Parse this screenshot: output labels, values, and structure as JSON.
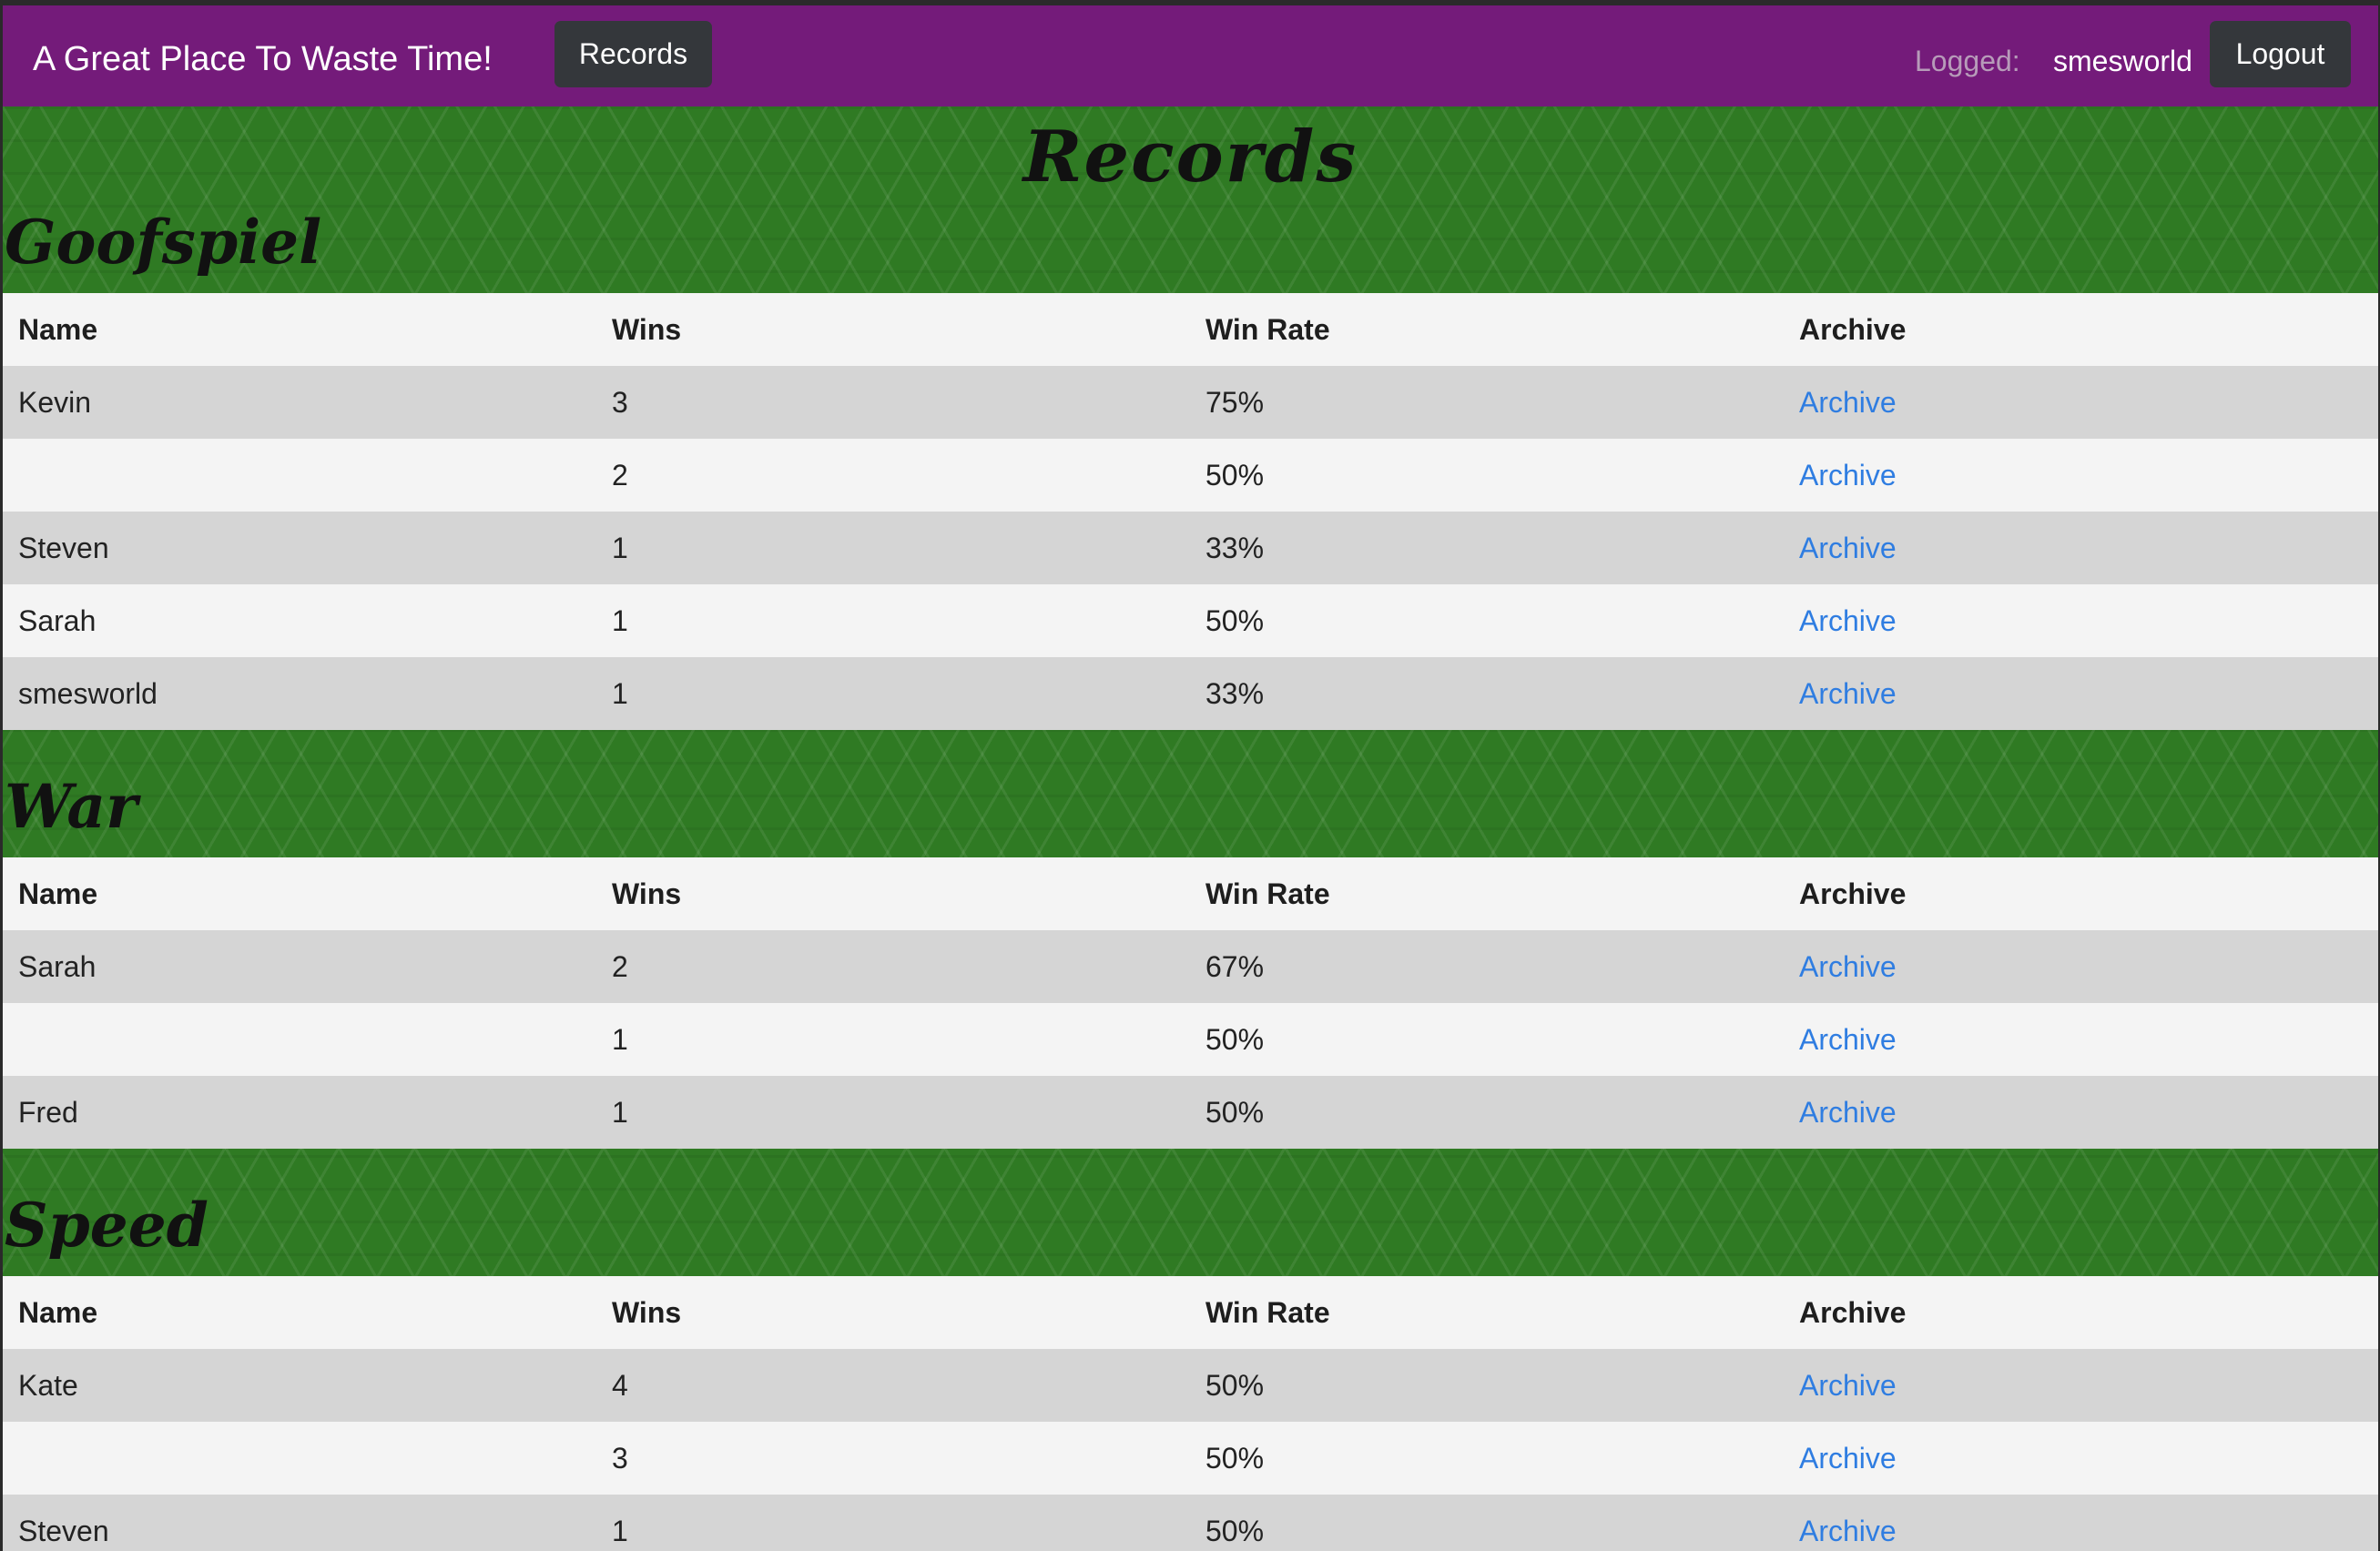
{
  "navbar": {
    "brand": "A Great Place To Waste Time!",
    "records_button": "Records",
    "logged_label": "Logged:",
    "username": "smesworld",
    "logout_button": "Logout"
  },
  "page": {
    "title": "Records"
  },
  "sections": [
    {
      "title": "Goofspiel",
      "headers": [
        "Name",
        "Wins",
        "Win Rate",
        "Archive"
      ],
      "rows": [
        {
          "name": "Kevin",
          "wins": "3",
          "rate": "75%",
          "archive": "Archive"
        },
        {
          "name": "",
          "wins": "2",
          "rate": "50%",
          "archive": "Archive"
        },
        {
          "name": "Steven",
          "wins": "1",
          "rate": "33%",
          "archive": "Archive"
        },
        {
          "name": "Sarah",
          "wins": "1",
          "rate": "50%",
          "archive": "Archive"
        },
        {
          "name": "smesworld",
          "wins": "1",
          "rate": "33%",
          "archive": "Archive"
        }
      ]
    },
    {
      "title": "War",
      "headers": [
        "Name",
        "Wins",
        "Win Rate",
        "Archive"
      ],
      "rows": [
        {
          "name": "Sarah",
          "wins": "2",
          "rate": "67%",
          "archive": "Archive"
        },
        {
          "name": "",
          "wins": "1",
          "rate": "50%",
          "archive": "Archive"
        },
        {
          "name": "Fred",
          "wins": "1",
          "rate": "50%",
          "archive": "Archive"
        }
      ]
    },
    {
      "title": "Speed",
      "headers": [
        "Name",
        "Wins",
        "Win Rate",
        "Archive"
      ],
      "rows": [
        {
          "name": "Kate",
          "wins": "4",
          "rate": "50%",
          "archive": "Archive"
        },
        {
          "name": "",
          "wins": "3",
          "rate": "50%",
          "archive": "Archive"
        },
        {
          "name": "Steven",
          "wins": "1",
          "rate": "50%",
          "archive": "Archive"
        }
      ]
    }
  ]
}
